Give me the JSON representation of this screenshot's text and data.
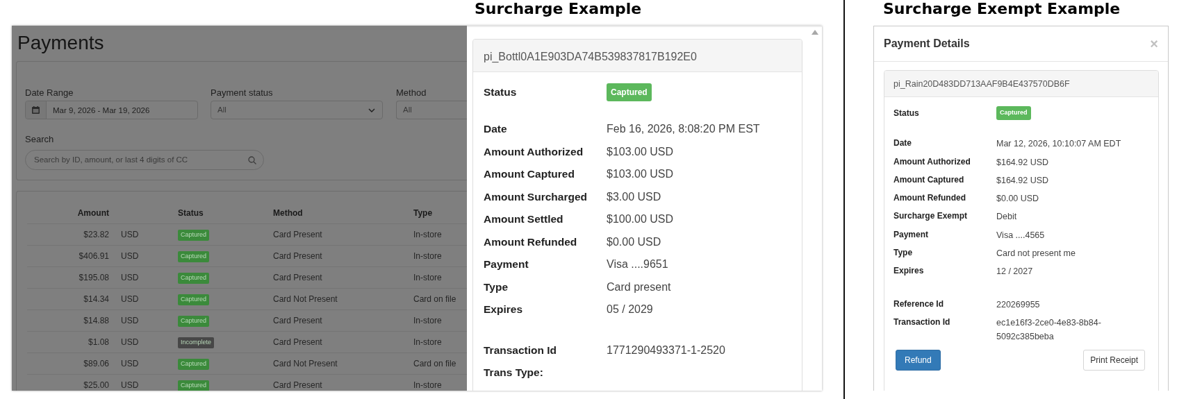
{
  "surcharge_example": {
    "heading": "Surcharge Example",
    "payments_page": {
      "title": "Payments",
      "filters": {
        "date_range": {
          "label": "Date Range",
          "value": "Mar 9, 2026 - Mar 19, 2026"
        },
        "payment_status": {
          "label": "Payment status",
          "value": "All"
        },
        "method": {
          "label": "Method",
          "value": "All"
        },
        "search": {
          "label": "Search",
          "placeholder": "Search by ID, amount, or last 4 digits of CC"
        }
      },
      "table": {
        "columns": [
          "Amount",
          "Status",
          "Method",
          "Type"
        ],
        "rows": [
          {
            "amount": "$23.82",
            "currency": "USD",
            "status": {
              "text": "Captured",
              "color": "#3b8a3b"
            },
            "method": "Card Present",
            "type": "In-store"
          },
          {
            "amount": "$406.91",
            "currency": "USD",
            "status": {
              "text": "Captured",
              "color": "#3b8a3b"
            },
            "method": "Card Present",
            "type": "In-store"
          },
          {
            "amount": "$195.08",
            "currency": "USD",
            "status": {
              "text": "Captured",
              "color": "#3b8a3b"
            },
            "method": "Card Present",
            "type": "In-store"
          },
          {
            "amount": "$14.34",
            "currency": "USD",
            "status": {
              "text": "Captured",
              "color": "#3b8a3b"
            },
            "method": "Card Not Present",
            "type": "Card on file"
          },
          {
            "amount": "$14.88",
            "currency": "USD",
            "status": {
              "text": "Captured",
              "color": "#3b8a3b"
            },
            "method": "Card Present",
            "type": "In-store"
          },
          {
            "amount": "$1.08",
            "currency": "USD",
            "status": {
              "text": "Incomplete",
              "color": "#474747"
            },
            "method": "Card Present",
            "type": "In-store"
          },
          {
            "amount": "$89.06",
            "currency": "USD",
            "status": {
              "text": "Captured",
              "color": "#3b8a3b"
            },
            "method": "Card Not Present",
            "type": "Card on file"
          },
          {
            "amount": "$25.00",
            "currency": "USD",
            "status": {
              "text": "Captured",
              "color": "#3b8a3b"
            },
            "method": "Card Present",
            "type": "In-store"
          }
        ]
      }
    },
    "detail_panel": {
      "id": "pi_Bottl0A1E903DA74B539837817B192E0",
      "groups": [
        [
          {
            "label": "Status",
            "kind": "badge",
            "value": "Captured"
          }
        ],
        [
          {
            "label": "Date",
            "kind": "text",
            "value": "Feb 16, 2026, 8:08:20 PM EST"
          },
          {
            "label": "Amount Authorized",
            "kind": "text",
            "value": "$103.00 USD"
          },
          {
            "label": "Amount Captured",
            "kind": "text",
            "value": "$103.00 USD"
          },
          {
            "label": "Amount Surcharged",
            "kind": "text",
            "value": "$3.00 USD"
          },
          {
            "label": "Amount Settled",
            "kind": "text",
            "value": "$100.00 USD"
          },
          {
            "label": "Amount Refunded",
            "kind": "text",
            "value": "$0.00 USD"
          },
          {
            "label": "Payment",
            "kind": "text",
            "value": "Visa ....9651"
          },
          {
            "label": "Type",
            "kind": "text",
            "value": "Card present"
          },
          {
            "label": "Expires",
            "kind": "text",
            "value": "05 / 2029"
          }
        ],
        [
          {
            "label": "Transaction Id",
            "kind": "text",
            "value": "1771290493371-1-2520"
          },
          {
            "label": "Trans Type:",
            "kind": "text"
          }
        ]
      ]
    }
  },
  "surcharge_exempt_example": {
    "heading": "Surcharge Exempt Example",
    "modal": {
      "title": "Payment Details",
      "close": "×",
      "id": "pi_Rain20D483DD713AAF9B4E437570DB6F",
      "groups": [
        [
          {
            "label": "Status",
            "kind": "badge",
            "value": "Captured"
          }
        ],
        [
          {
            "label": "Date",
            "kind": "text",
            "value": "Mar 12, 2026, 10:10:07 AM EDT"
          },
          {
            "label": "Amount Authorized",
            "kind": "text",
            "value": "$164.92 USD"
          },
          {
            "label": "Amount Captured",
            "kind": "text",
            "value": "$164.92 USD"
          },
          {
            "label": "Amount Refunded",
            "kind": "text",
            "value": "$0.00 USD"
          },
          {
            "label": "Surcharge Exempt",
            "kind": "text",
            "value": "Debit"
          },
          {
            "label": "Payment",
            "kind": "text",
            "value": "Visa ....4565"
          },
          {
            "label": "Type",
            "kind": "text",
            "value": "Card not present me"
          },
          {
            "label": "Expires",
            "kind": "text",
            "value": "12 / 2027"
          }
        ],
        [
          {
            "label": "Reference Id",
            "kind": "text",
            "value": "220269955"
          },
          {
            "label": "Transaction Id",
            "kind": "text",
            "value": "ec1e16f3-2ce0-4e83-8b84-5092c385beba"
          }
        ]
      ],
      "buttons": [
        {
          "label": "Refund",
          "kind": "primary"
        },
        {
          "label": "Print Receipt",
          "kind": "secondary"
        }
      ]
    }
  }
}
